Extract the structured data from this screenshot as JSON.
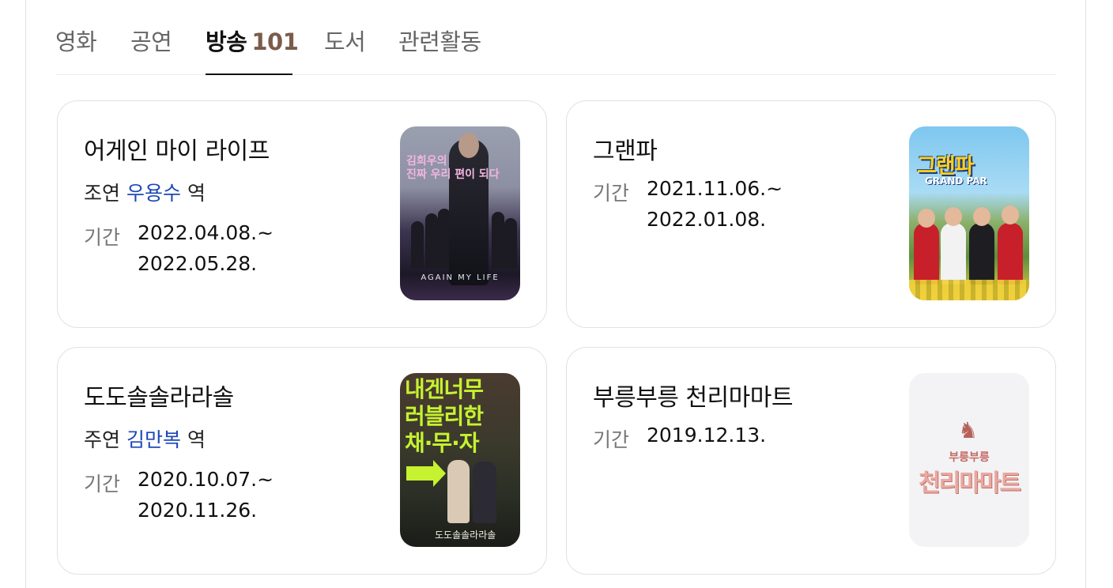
{
  "tabs": [
    {
      "label": "영화",
      "active": false
    },
    {
      "label": "공연",
      "active": false
    },
    {
      "label": "방송",
      "count": "101",
      "active": true
    },
    {
      "label": "도서",
      "active": false
    },
    {
      "label": "관련활동",
      "active": false
    }
  ],
  "cards": [
    {
      "title": "어게인 마이 라이프",
      "role_prefix": "조연",
      "actor": "우용수",
      "role_suffix": "역",
      "period_label": "기간",
      "period_start": "2022.04.08.~",
      "period_end": "2022.05.28.",
      "poster": {
        "text_ko": "김희우의\n진짜 우리 편이 되다",
        "text_en": "AGAIN MY LIFE"
      }
    },
    {
      "title": "그랜파",
      "period_label": "기간",
      "period_start": "2021.11.06.~",
      "period_end": "2022.01.08.",
      "poster": {
        "logo_ko": "그랜파",
        "logo_en": "GRAND PAR"
      }
    },
    {
      "title": "도도솔솔라라솔",
      "role_prefix": "주연",
      "actor": "김만복",
      "role_suffix": "역",
      "period_label": "기간",
      "period_start": "2020.10.07.~",
      "period_end": "2020.11.26.",
      "poster": {
        "line1": "내겐너무",
        "line2": "러블리한",
        "line3": "채·무·자",
        "small_title": "도도솔솔라라솔"
      }
    },
    {
      "title": "부릉부릉 천리마마트",
      "period_label": "기간",
      "period_start": "2019.12.13.",
      "poster": {
        "sub": "부릉부릉",
        "main": "천리마마트"
      }
    }
  ],
  "colors": {
    "actor_link": "#1c47b8",
    "tab_count": "#7b5b4a",
    "card_border": "#e1e1e6"
  }
}
